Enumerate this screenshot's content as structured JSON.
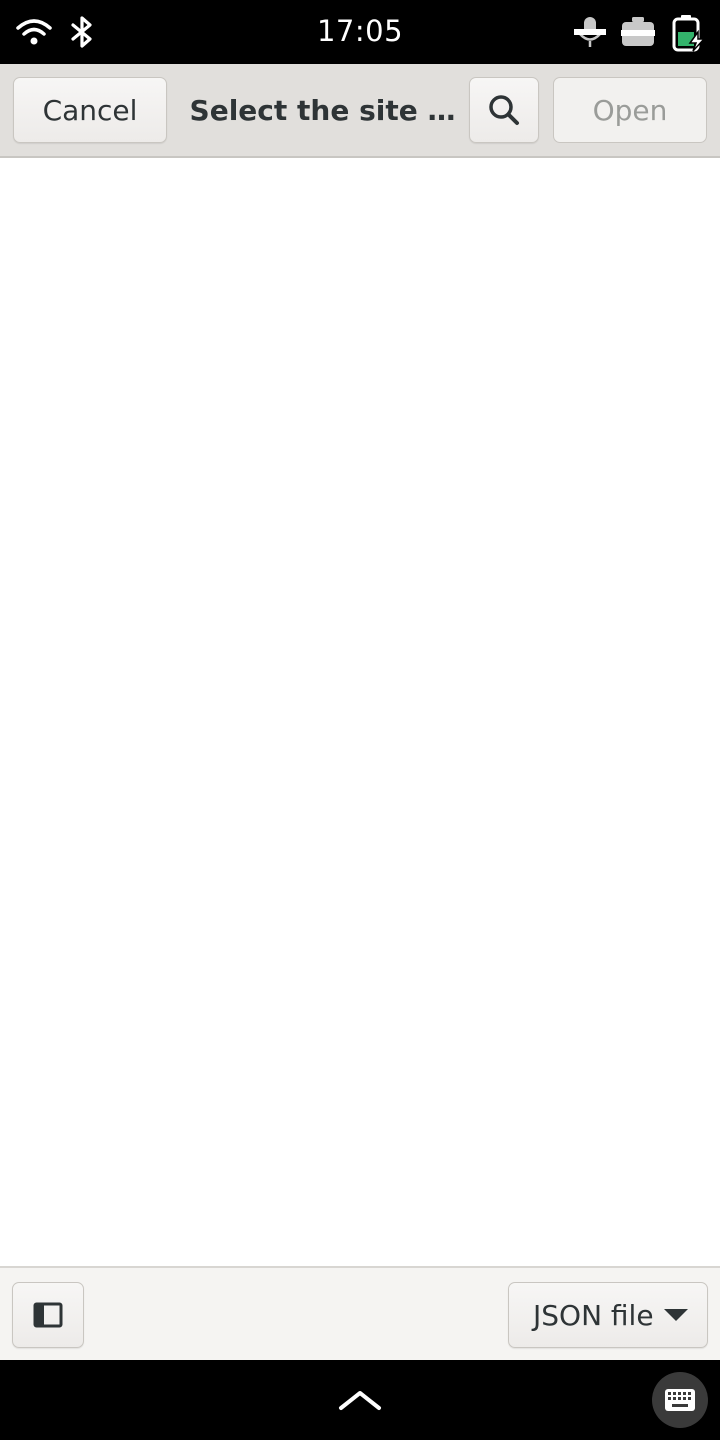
{
  "status_bar": {
    "time": "17:05",
    "icons": [
      "wifi-icon",
      "bluetooth-icon",
      "microphone-muted-icon",
      "camera-off-icon",
      "battery-charging-icon"
    ]
  },
  "header": {
    "cancel_label": "Cancel",
    "title": "Select the site …",
    "search_icon": "search-icon",
    "open_label": "Open"
  },
  "footer": {
    "sidebar_toggle_icon": "sidebar-toggle-icon",
    "filter_selected": "JSON file",
    "filter_dropdown_icon": "caret-down-icon"
  },
  "nav_bar": {
    "home_icon": "chevron-up-icon",
    "keyboard_icon": "keyboard-icon"
  },
  "colors": {
    "header_bg": "#e1dfdc",
    "content_bg": "#ffffff",
    "battery_accent": "#33b36b"
  }
}
